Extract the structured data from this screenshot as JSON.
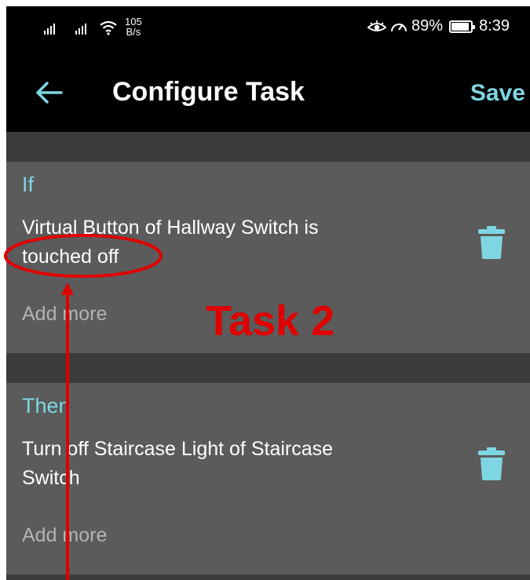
{
  "status_bar": {
    "net_speed_value": "105",
    "net_speed_unit": "B/s",
    "battery": "89%",
    "time": "8:39"
  },
  "header": {
    "title": "Configure Task",
    "save_label": "Save"
  },
  "if_section": {
    "label": "If",
    "condition": "Virtual Button of Hallway Switch is touched off",
    "add_more": "Add more"
  },
  "then_section": {
    "label": "Then",
    "action": "Turn off Staircase Light of Staircase Switch",
    "add_more": "Add more"
  },
  "annotation": {
    "label": "Task 2",
    "color": "#e00000"
  },
  "colors": {
    "accent": "#7fd6e3",
    "card": "#5b5b5b",
    "background": "#3a3a3a"
  }
}
